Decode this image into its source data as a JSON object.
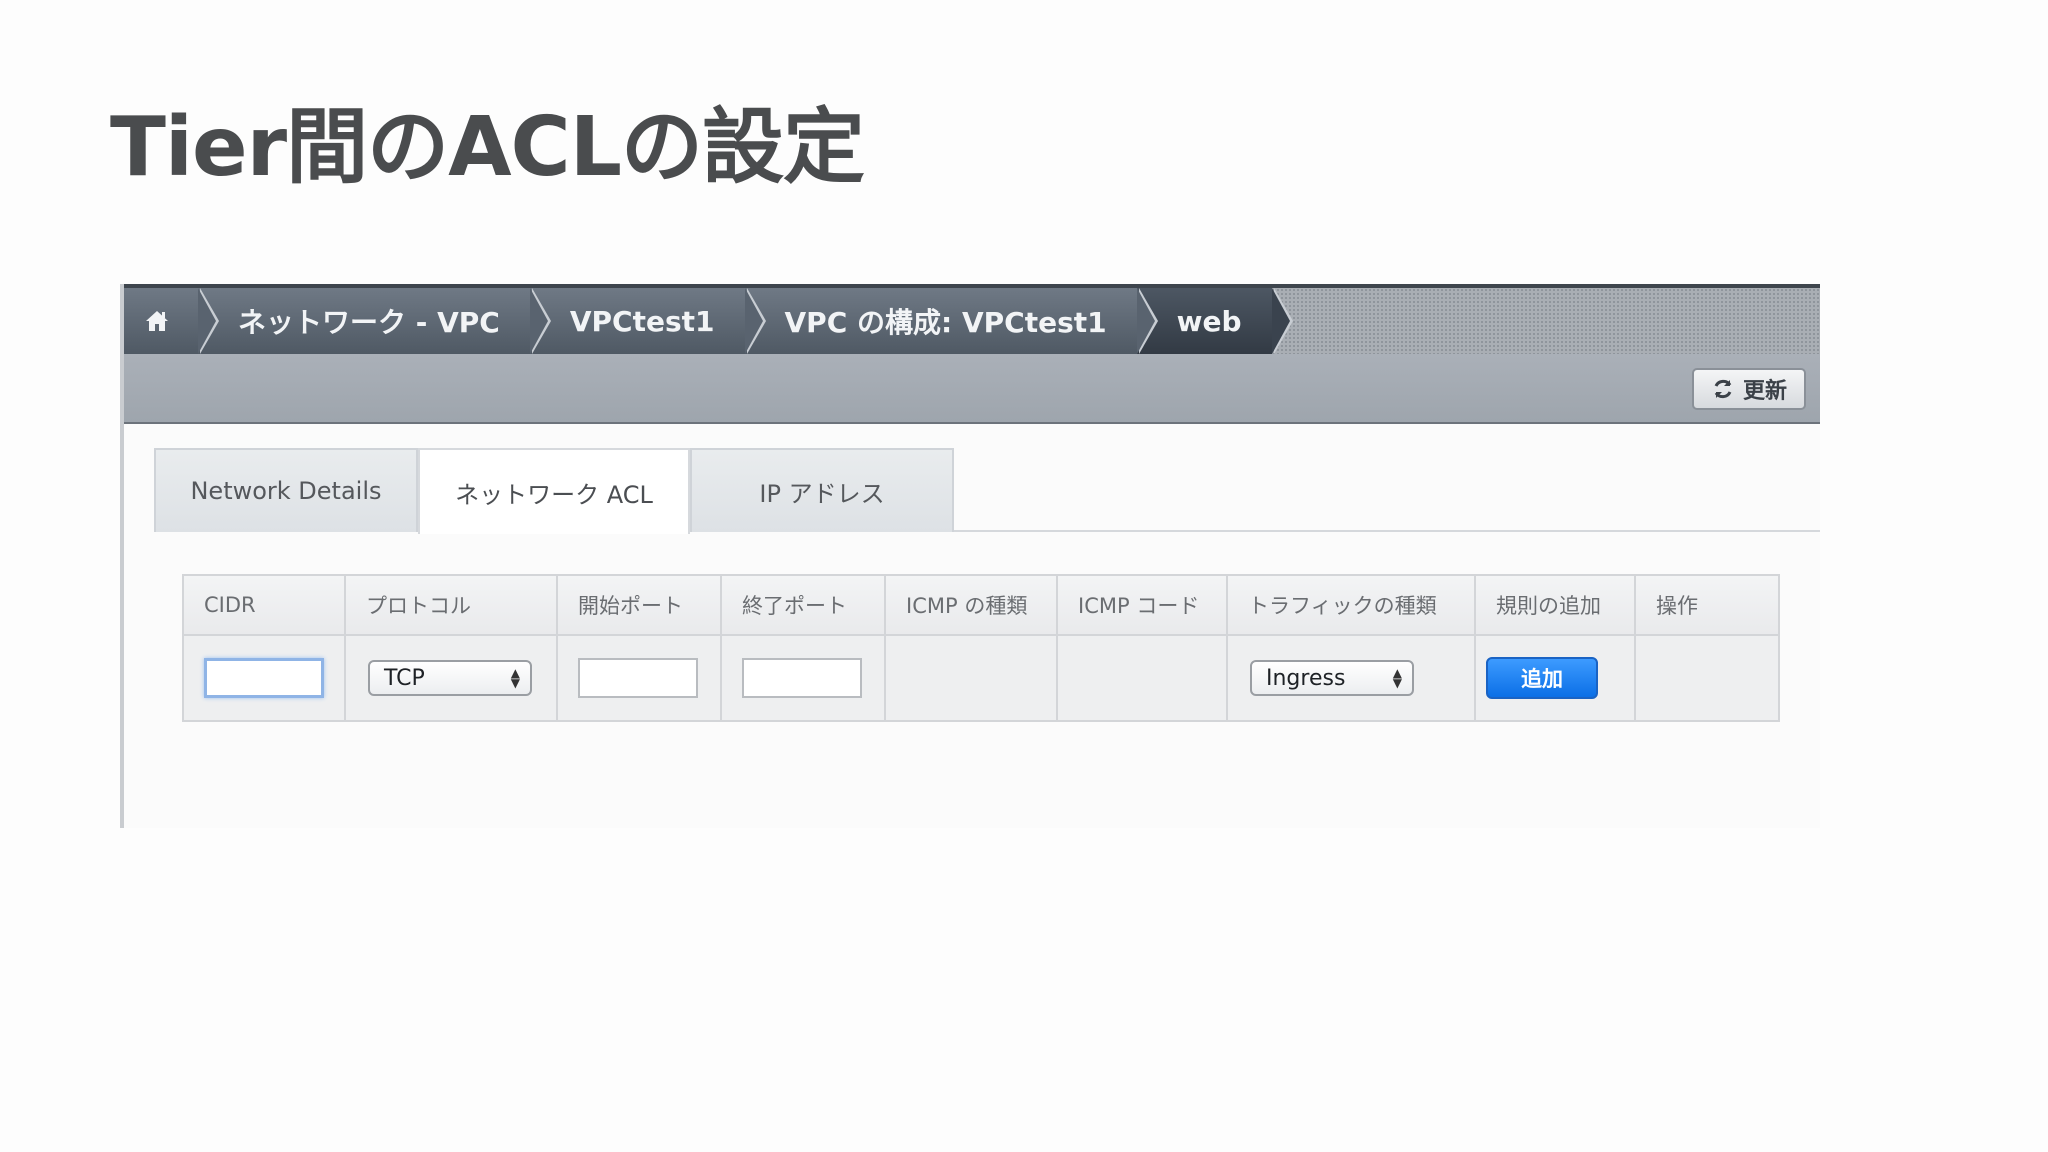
{
  "slide": {
    "title": "Tier間のACLの設定"
  },
  "breadcrumb": {
    "home_icon": "home-icon",
    "items": [
      "ネットワーク - VPC",
      "VPCtest1",
      "VPC の構成: VPCtest1",
      "web"
    ]
  },
  "toolbar": {
    "refresh_label": "更新",
    "refresh_icon": "refresh-icon"
  },
  "tabs": [
    {
      "label": "Network Details",
      "active": false
    },
    {
      "label": "ネットワーク ACL",
      "active": true
    },
    {
      "label": "IP アドレス",
      "active": false
    }
  ],
  "acl_table": {
    "headers": [
      "CIDR",
      "プロトコル",
      "開始ポート",
      "終了ポート",
      "ICMP の種類",
      "ICMP コード",
      "トラフィックの種類",
      "規則の追加",
      "操作"
    ],
    "row": {
      "cidr_value": "",
      "protocol_selected": "TCP",
      "start_port_value": "",
      "end_port_value": "",
      "traffic_selected": "Ingress",
      "add_label": "追加"
    }
  },
  "colors": {
    "accent": "#0b6fe6",
    "crumb_bar": "#59636f",
    "title": "#4a4c4e"
  }
}
